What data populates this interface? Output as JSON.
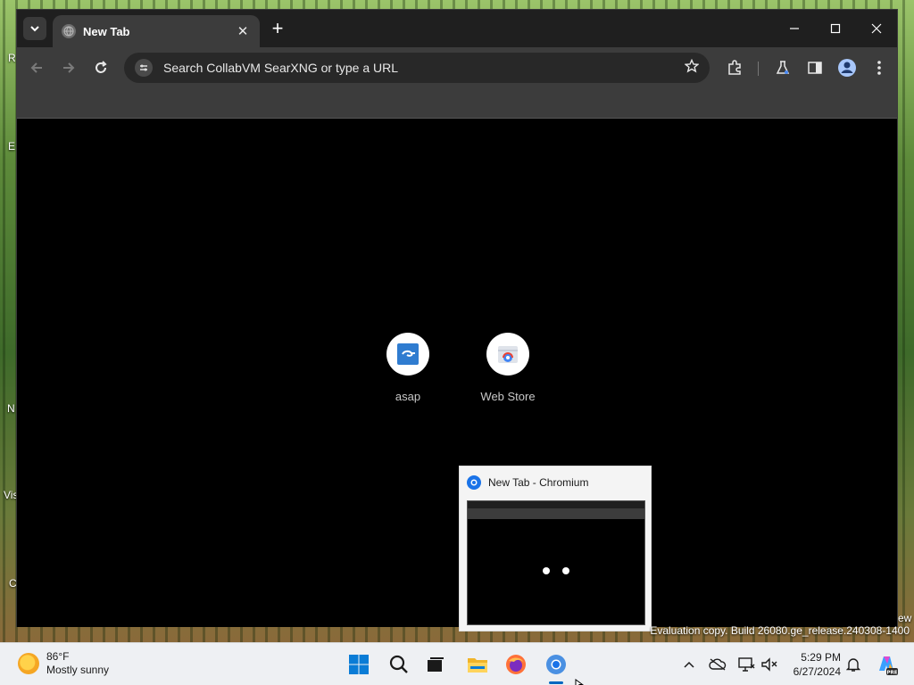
{
  "browser": {
    "tab_title": "New Tab",
    "omnibox_placeholder": "Search CollabVM SearXNG or type a URL"
  },
  "shortcuts": [
    {
      "label": "asap"
    },
    {
      "label": "Web Store"
    }
  ],
  "preview": {
    "title": "New Tab - Chromium"
  },
  "desktop": {
    "edge_labels": [
      "R",
      "E",
      "N",
      "Vis",
      "C"
    ],
    "edge_label_right": "ew",
    "eval_notice": "Evaluation copy. Build 26080.ge_release.240308-1400"
  },
  "taskbar": {
    "weather_temp": "86°F",
    "weather_desc": "Mostly sunny",
    "time": "5:29 PM",
    "date": "6/27/2024"
  },
  "colors": {
    "tabstrip": "#1f1f1f",
    "toolbar": "#3c3c3c",
    "content": "#000000",
    "taskbar": "#eef0f3",
    "accent": "#0067c0"
  }
}
